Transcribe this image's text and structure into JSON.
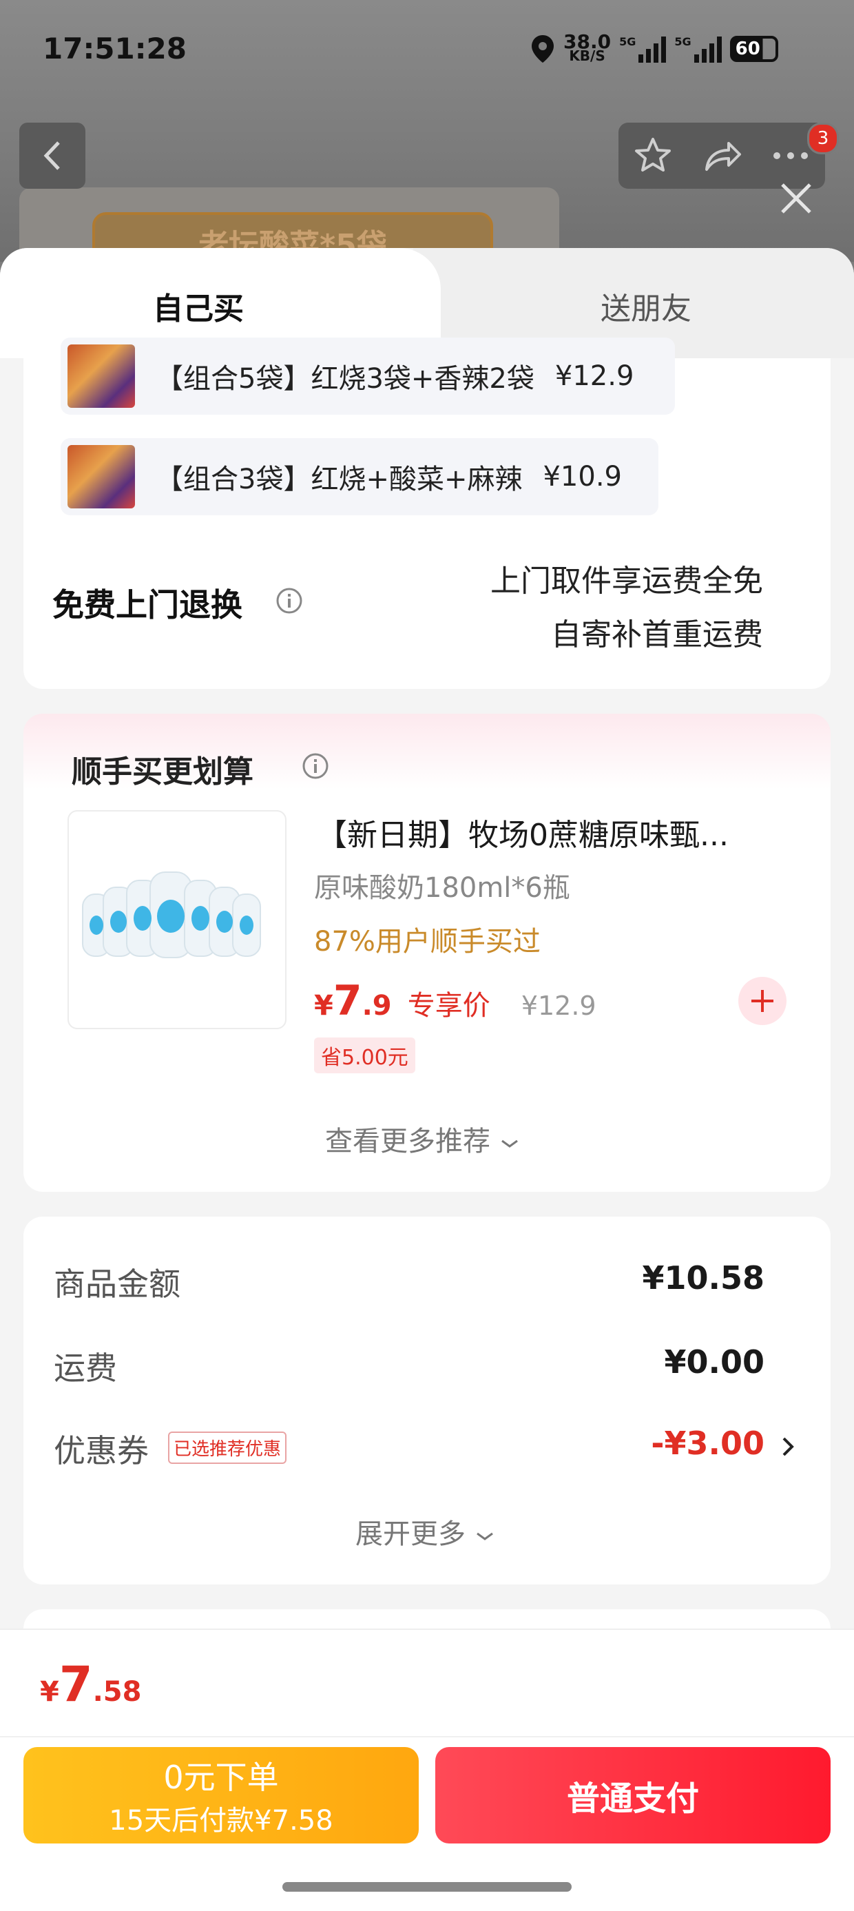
{
  "status_bar": {
    "time": "17:51:28",
    "net_speed_value": "38.0",
    "net_speed_unit": "KB/S",
    "signal_1": "5G",
    "signal_2": "5G",
    "battery": "60"
  },
  "background": {
    "banner_text": "老坛酸菜*5袋",
    "cart_badge": "3"
  },
  "tabs": {
    "self_buy": "自己买",
    "gift": "送朋友"
  },
  "combos": [
    {
      "label": "【组合5袋】红烧3袋+香辣2袋",
      "price": "¥12.9"
    },
    {
      "label": "【组合3袋】红烧+酸菜+麻辣",
      "price": "¥10.9"
    }
  ],
  "return_policy": {
    "title": "免费上门退换",
    "line1": "上门取件享运费全免",
    "line2": "自寄补首重运费"
  },
  "addon": {
    "section_title": "顺手买更划算",
    "product_title": "【新日期】牧场0蔗糖原味甄...",
    "product_spec": "原味酸奶180ml*6瓶",
    "purchase_rate": "87%用户顺手买过",
    "price_symbol": "¥",
    "price_int": "7",
    "price_dec": ".9",
    "price_tag": "专享价",
    "original_price": "¥12.9",
    "saving": "省5.00元",
    "more_link": "查看更多推荐"
  },
  "summary": {
    "goods_label": "商品金额",
    "goods_value": "¥10.58",
    "shipping_label": "运费",
    "shipping_value": "¥0.00",
    "coupon_label": "优惠券",
    "coupon_tag": "已选推荐优惠",
    "coupon_value": "-¥3.00",
    "expand": "展开更多"
  },
  "footer": {
    "total_symbol": "¥",
    "total_int": "7",
    "total_dec": ".58",
    "later_pay_title": "0元下单",
    "later_pay_sub": "15天后付款¥7.58",
    "normal_pay": "普通支付"
  },
  "colors": {
    "accent_red": "#e02e24",
    "orange_text": "#c98a2a",
    "later_pay_start": "#ffc21d",
    "later_pay_end": "#ffa70f",
    "normal_pay_start": "#ff4a57",
    "normal_pay_end": "#ff1a2e"
  }
}
